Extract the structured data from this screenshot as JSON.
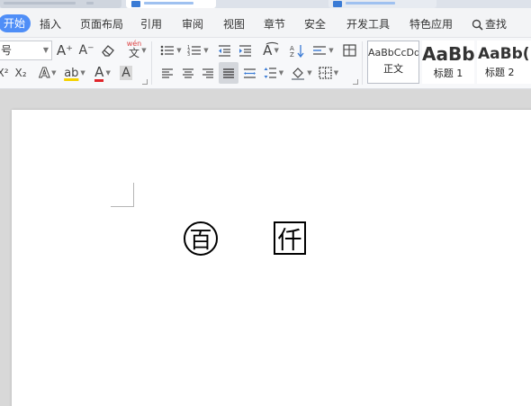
{
  "ribbon": {
    "tabs": [
      {
        "label": "开始",
        "active": true
      },
      {
        "label": "插入"
      },
      {
        "label": "页面布局"
      },
      {
        "label": "引用"
      },
      {
        "label": "审阅"
      },
      {
        "label": "视图"
      },
      {
        "label": "章节"
      },
      {
        "label": "安全"
      },
      {
        "label": "开发工具"
      },
      {
        "label": "特色应用"
      }
    ],
    "search_label": "查找",
    "accent_color": "#4f8ef7"
  },
  "toolbar": {
    "font_size_value": "号",
    "grow_font": "A⁺",
    "shrink_font": "A⁻",
    "phonetic_top": "wén",
    "phonetic_char": "文",
    "superscript": "X²",
    "subscript": "X₂",
    "text_effect": "A",
    "highlight": "ab",
    "font_color": "A",
    "char_shading": "A",
    "styles": [
      {
        "sample": "AaBbCcDd",
        "label": "正文",
        "selected": true
      },
      {
        "sample": "AaBb",
        "label": "标题 1"
      },
      {
        "sample": "AaBb(",
        "label": "标题 2"
      }
    ]
  },
  "document": {
    "enclosed_circle_char": "百",
    "enclosed_square_char": "仟"
  }
}
